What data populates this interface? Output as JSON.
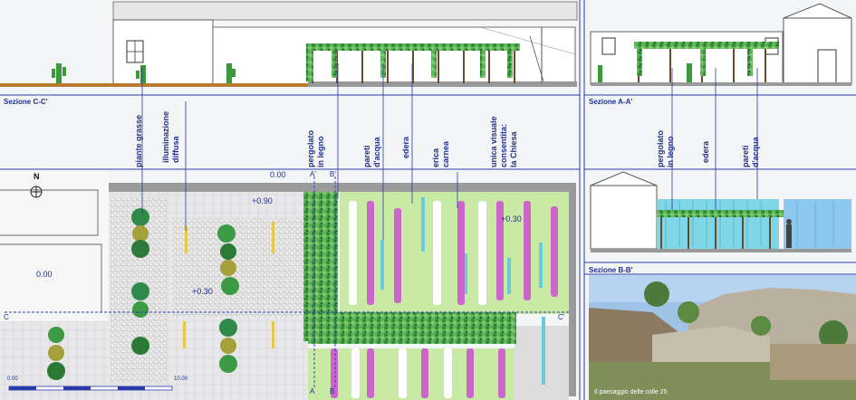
{
  "sections": {
    "cc_title": "Sezione  C-C'",
    "aa_title": "Sezione A-A'",
    "bb_title": "Sezione B-B'"
  },
  "labels_left": [
    "piante grasse",
    "illuminazione",
    "diffusa",
    "pergolato",
    "in legno",
    "pareti",
    "d'acqua",
    "edera",
    "erica",
    "carnea",
    "unica visuale",
    "consentita:",
    "la Chiesa"
  ],
  "labels_right": [
    "pergolato",
    "in legno",
    "edera",
    "pareti",
    "d'acqua"
  ],
  "plan": {
    "north": "N",
    "elev_000_top": "0.00",
    "elev_090": "+0.90",
    "elev_030_right": "+0.30",
    "elev_030_left": "+0.30",
    "elev_000_left": "0.00",
    "section_a": "A'",
    "section_b": "B'",
    "section_a_bottom": "A",
    "section_b_bottom": "B",
    "section_c": "C",
    "section_c_right": "C'",
    "scale_ticks": [
      "0.00",
      "",
      "",
      "",
      "",
      "",
      "10.00"
    ]
  },
  "photo": {
    "caption": "Il paesaggio delle colle 25"
  },
  "colors": {
    "line_blue": "#2a3aa8",
    "label_blue": "#1f2f8f",
    "lawn": "#c9eaa4",
    "water": "#66ccdd",
    "gravel": "#dddddd",
    "wall": "#9a9a9a",
    "vine": "#2e9a3e",
    "heather": "#cc66cc"
  }
}
